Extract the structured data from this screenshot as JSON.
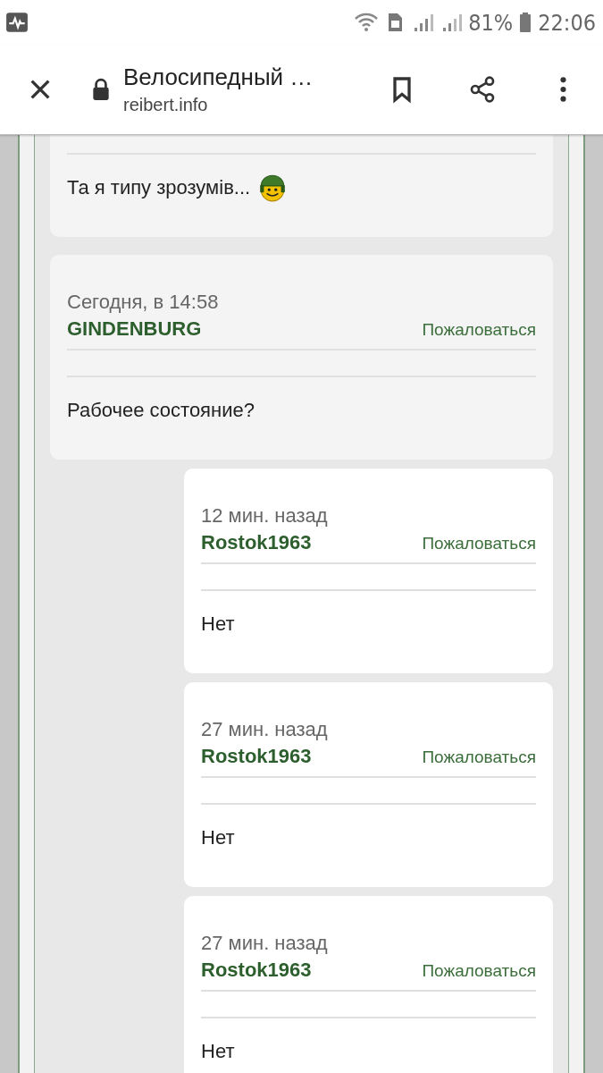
{
  "status_bar": {
    "battery": "81%",
    "time": "22:06"
  },
  "toolbar": {
    "title": "Велосипедный …",
    "url": "reibert.info"
  },
  "posts": [
    {
      "kind": "cut",
      "body": "Та я типу зрозумів...",
      "emoji": true
    },
    {
      "kind": "post",
      "date": "Сегодня, в 14:58",
      "author": "GINDENBURG",
      "report": "Пожаловаться",
      "body": "Рабочее состояние?",
      "emoji": false
    },
    {
      "kind": "reply",
      "date": "12 мин. назад",
      "author": "Rostok1963",
      "report": "Пожаловаться",
      "body": "Нет",
      "emoji": false
    },
    {
      "kind": "reply",
      "date": "27 мин. назад",
      "author": "Rostok1963",
      "report": "Пожаловаться",
      "body": "Нет",
      "emoji": false
    },
    {
      "kind": "reply",
      "date": "27 мин. назад",
      "author": "Rostok1963",
      "report": "Пожаловаться",
      "body": "Нет",
      "emoji": false
    }
  ]
}
